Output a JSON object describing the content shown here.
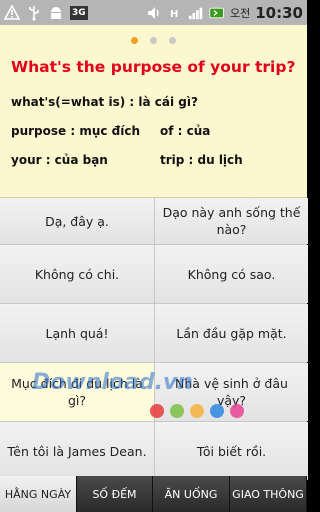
{
  "statusbar": {
    "network": "3G",
    "ampm": "오전",
    "time": "10:30"
  },
  "card": {
    "pager_dots": 3,
    "active_dot": 0,
    "title": "What's the purpose of your trip?",
    "vocab": [
      "what's(=what is) : là cái gì?",
      "purpose : mục đích",
      "of : của",
      "your : của bạn",
      "trip : du lịch"
    ]
  },
  "phrases": [
    "Dạ, đây ạ.",
    "Dạo này anh sống thế nào?",
    "Không có chi.",
    "Không có sao.",
    "Lạnh quá!",
    "Lần đầu gặp mặt.",
    "Mục đích đi du lịch là gì?",
    "Nhà vệ sinh ở đâu vậy?",
    "Tên tôi là James Dean.",
    "Tôi biết rồi."
  ],
  "watermark": "Download.vn",
  "tabs": [
    "HẰNG NGÀY",
    "SỐ ĐẾM",
    "ĂN UỐNG",
    "GIAO THÔNG"
  ],
  "colors": {
    "title_red": "#e2001b",
    "card_bg": "#fdf7cf",
    "dot_active": "#f2a01d"
  }
}
